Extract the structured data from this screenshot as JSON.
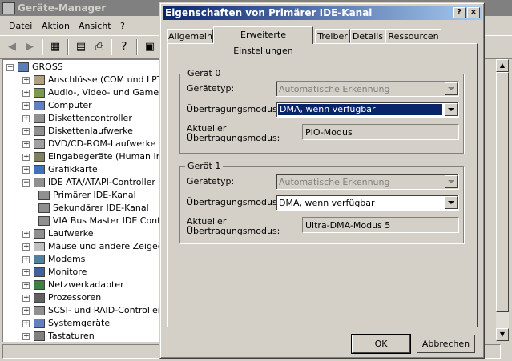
{
  "device_manager": {
    "title": "Geräte-Manager",
    "menu": [
      "Datei",
      "Aktion",
      "Ansicht",
      "?"
    ],
    "tree": [
      {
        "label": "GROSS",
        "level": 0,
        "expander": "−"
      },
      {
        "label": "Anschlüsse (COM und LPT)",
        "level": 1,
        "expander": "+"
      },
      {
        "label": "Audio-, Video- und Gamecon",
        "level": 1,
        "expander": "+"
      },
      {
        "label": "Computer",
        "level": 1,
        "expander": "+"
      },
      {
        "label": "Diskettencontroller",
        "level": 1,
        "expander": "+"
      },
      {
        "label": "Diskettenlaufwerke",
        "level": 1,
        "expander": "+"
      },
      {
        "label": "DVD/CD-ROM-Laufwerke",
        "level": 1,
        "expander": "+"
      },
      {
        "label": "Eingabegeräte (Human Inter",
        "level": 1,
        "expander": "+"
      },
      {
        "label": "Grafikkarte",
        "level": 1,
        "expander": "+"
      },
      {
        "label": "IDE ATA/ATAPI-Controller",
        "level": 1,
        "expander": "−"
      },
      {
        "label": "Primärer IDE-Kanal",
        "level": 2,
        "expander": ""
      },
      {
        "label": "Sekundärer IDE-Kanal",
        "level": 2,
        "expander": ""
      },
      {
        "label": "VIA Bus Master IDE Cont",
        "level": 2,
        "expander": ""
      },
      {
        "label": "Laufwerke",
        "level": 1,
        "expander": "+"
      },
      {
        "label": "Mäuse und andere Zeigeger",
        "level": 1,
        "expander": "+"
      },
      {
        "label": "Modems",
        "level": 1,
        "expander": "+"
      },
      {
        "label": "Monitore",
        "level": 1,
        "expander": "+"
      },
      {
        "label": "Netzwerkadapter",
        "level": 1,
        "expander": "+"
      },
      {
        "label": "Prozessoren",
        "level": 1,
        "expander": "+"
      },
      {
        "label": "SCSI- und RAID-Controller",
        "level": 1,
        "expander": "+"
      },
      {
        "label": "Systemgeräte",
        "level": 1,
        "expander": "+"
      },
      {
        "label": "Tastaturen",
        "level": 1,
        "expander": "+"
      }
    ]
  },
  "dialog": {
    "title": "Eigenschaften von Primärer IDE-Kanal",
    "help_button": "?",
    "close_button": "×",
    "tabs": [
      "Allgemein",
      "Erweiterte Einstellungen",
      "Treiber",
      "Details",
      "Ressourcen"
    ],
    "active_tab": "Erweiterte Einstellungen",
    "device0": {
      "group_label": "Gerät 0",
      "type_label": "Gerätetyp:",
      "type_value": "Automatische Erkennung",
      "mode_label": "Übertragungsmodus:",
      "mode_value": "DMA, wenn verfügbar",
      "current_label_1": "Aktueller",
      "current_label_2": "Übertragungsmodus:",
      "current_value": "PIO-Modus"
    },
    "device1": {
      "group_label": "Gerät 1",
      "type_label": "Gerätetyp:",
      "type_value": "Automatische Erkennung",
      "mode_label": "Übertragungsmodus:",
      "mode_value": "DMA, wenn verfügbar",
      "current_label_1": "Aktueller",
      "current_label_2": "Übertragungsmodus:",
      "current_value": "Ultra-DMA-Modus 5"
    },
    "ok_button": "OK",
    "cancel_button": "Abbrechen"
  }
}
